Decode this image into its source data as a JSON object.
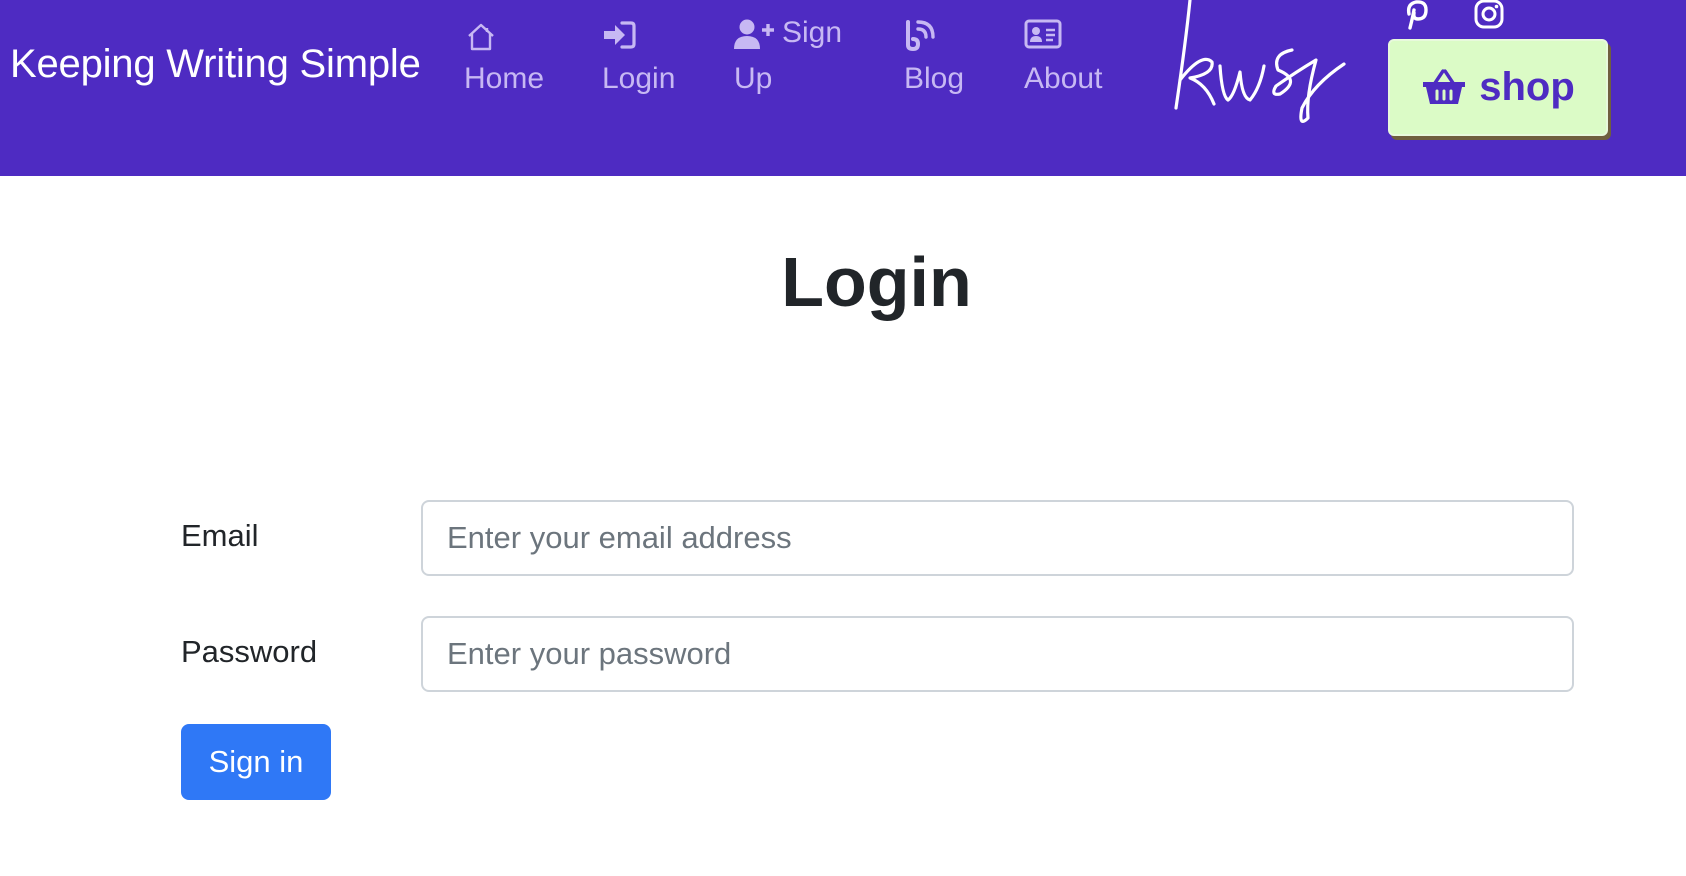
{
  "navbar": {
    "brand": "Keeping Writing Simple",
    "items": [
      {
        "label": "Home",
        "icon": "home-icon"
      },
      {
        "label": "Login",
        "icon": "login-icon"
      },
      {
        "label_line1": "Sign",
        "label_line2": "Up",
        "icon": "user-plus-icon"
      },
      {
        "label": "Blog",
        "icon": "rss-icon"
      },
      {
        "label": "About",
        "icon": "id-card-icon"
      }
    ],
    "logo_text": "kws",
    "social": [
      "pinterest-icon",
      "instagram-icon"
    ],
    "shop_label": "shop",
    "colors": {
      "background": "#4e2bc2",
      "link": "#c7b8f3",
      "shop_background": "#dbfbc6"
    }
  },
  "main": {
    "title": "Login",
    "email_label": "Email",
    "email_placeholder": "Enter your email address",
    "password_label": "Password",
    "password_placeholder": "Enter your password",
    "submit_label": "Sign in",
    "colors": {
      "submit": "#2f78f6"
    }
  }
}
